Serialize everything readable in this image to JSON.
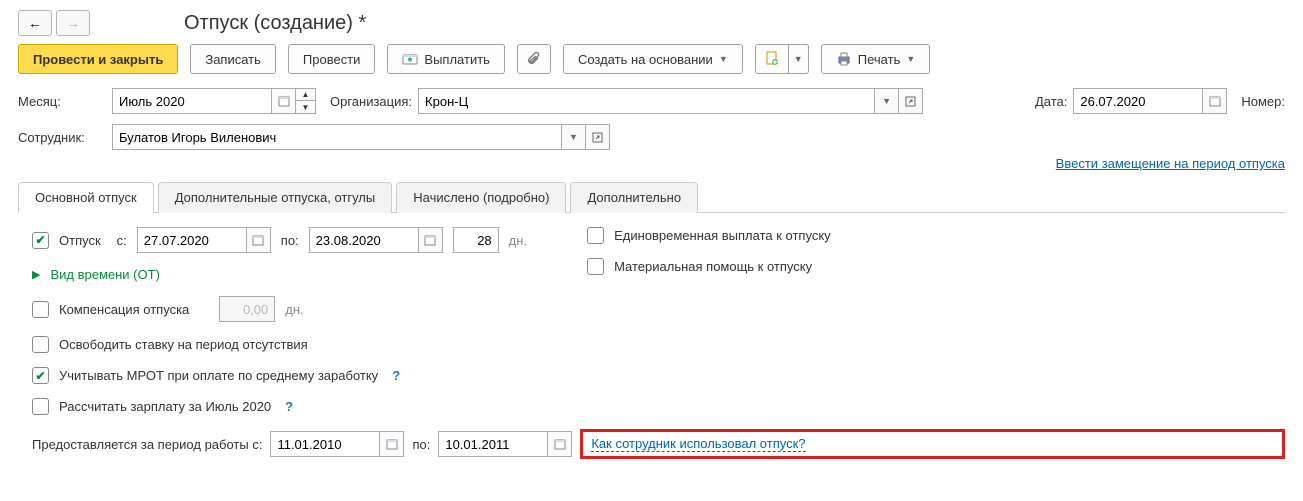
{
  "header": {
    "title": "Отпуск (создание) *"
  },
  "toolbar": {
    "post_close": "Провести и закрыть",
    "save": "Записать",
    "post": "Провести",
    "pay": "Выплатить",
    "create_based": "Создать на основании",
    "print": "Печать"
  },
  "fields": {
    "month_label": "Месяц:",
    "month_value": "Июль 2020",
    "org_label": "Организация:",
    "org_value": "Крон-Ц",
    "date_label": "Дата:",
    "date_value": "26.07.2020",
    "number_label": "Номер:",
    "employee_label": "Сотрудник:",
    "employee_value": "Булатов Игорь Виленович",
    "substitution_link": "Ввести замещение на период отпуска"
  },
  "tabs": {
    "main": "Основной отпуск",
    "additional": "Дополнительные отпуска, отгулы",
    "accrued": "Начислено (подробно)",
    "extra": "Дополнительно"
  },
  "main_tab": {
    "vacation_label": "Отпуск",
    "from_label": "с:",
    "from_value": "27.07.2020",
    "to_label": "по:",
    "to_value": "23.08.2020",
    "days_value": "28",
    "days_unit": "дн.",
    "time_type_link": "Вид времени (ОТ)",
    "compensation_label": "Компенсация отпуска",
    "compensation_value": "0,00",
    "compensation_unit": "дн.",
    "free_rate_label": "Освободить ставку на период отсутствия",
    "mrot_label": "Учитывать МРОТ при оплате по среднему заработку",
    "calc_salary_label": "Рассчитать зарплату за Июль 2020",
    "one_time_label": "Единовременная выплата к отпуску",
    "material_help_label": "Материальная помощь к отпуску",
    "period_label": "Предоставляется за период работы с:",
    "period_from": "11.01.2010",
    "period_to_label": "по:",
    "period_to": "10.01.2011",
    "usage_link": "Как сотрудник использовал отпуск?"
  }
}
